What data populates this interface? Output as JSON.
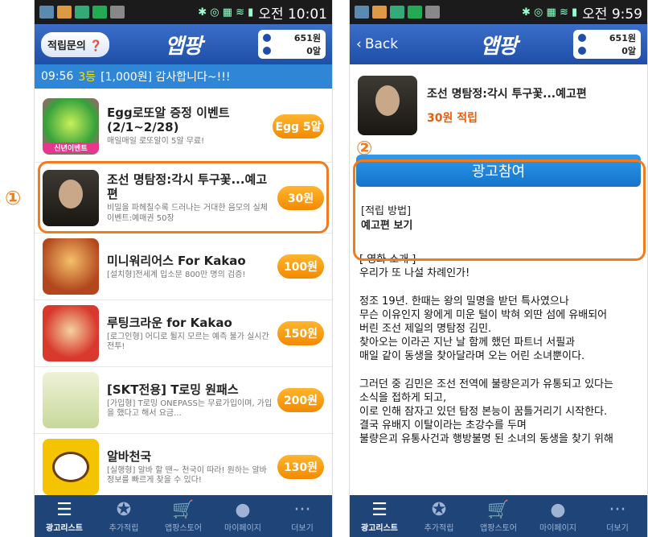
{
  "left": {
    "status": {
      "time": "오전 10:01"
    },
    "header": {
      "left_button": "적립문의",
      "logo": "앱팡",
      "points": [
        {
          "value": "651원"
        },
        {
          "value": "0알"
        }
      ]
    },
    "ticker": {
      "time": "09:56",
      "rank": "3등",
      "message": "[1,000원] 감사합니다~!!!"
    },
    "items": [
      {
        "title": "Egg로또알 증정 이벤트 (2/1~2/28)",
        "desc": "매일매일 로또알이 5알 무료!",
        "badge": "신년이벤트",
        "reward": "Egg 5알"
      },
      {
        "title": "조선 명탐정:각시 투구꽃...예고편",
        "desc": "비밀을 파헤칠수록 드러나는 거대한 음모의 실체",
        "desc2": "이벤트:예매권 50장",
        "reward": "30원"
      },
      {
        "title": "미니워리어스 For Kakao",
        "desc": "[설치형]전세계 입소문 800만 명의 검증!",
        "reward": "100원"
      },
      {
        "title": "루팅크라운 for Kakao",
        "desc": "[로그인형] 어디로 튈지 모르는 예측 불가 실시간 전투!",
        "reward": "150원"
      },
      {
        "title": "[SKT전용] T로밍 원패스",
        "desc": "[가입형] T로밍 ONEPASS는 무료가입이며, 가입을 했다고 해서 요금...",
        "reward": "200원"
      },
      {
        "title": "알바천국",
        "desc": "[실행형] 알바 할 땐~ 천국이 따라! 원하는 알바정보를 빠르게 찾을 수 있다!",
        "reward": "130원"
      }
    ],
    "marker": "①"
  },
  "right": {
    "status": {
      "time": "오전 9:59"
    },
    "header": {
      "back": "Back",
      "logo": "앱팡",
      "points": [
        {
          "value": "651원"
        },
        {
          "value": "0알"
        }
      ]
    },
    "detail": {
      "title": "조선 명탐정:각시 투구꽃...예고편",
      "reward": "30원 적립"
    },
    "marker": "②",
    "join_button": "광고참여",
    "how": {
      "label": "[적립 방법]",
      "text": "예고편 보기"
    },
    "story": {
      "heading": "[ 영화 소개 ]",
      "subheading": "우리가 또 나설 차례인가!",
      "para1": [
        "정조 19년. 한때는 왕의 밀명을 받던 특사였으나",
        "무슨 이유인지 왕에게 미운 털이 박혀 외딴 섬에 유배되어",
        "버린 조선 제일의 명탐정 김민.",
        "찾아오는 이라곤 지난 날 함께 했던 파트너 서필과",
        "매일 같이 동생을 찾아달라며 오는 어린 소녀뿐이다."
      ],
      "para2": [
        "그러던 중 김민은 조선 전역에 불량은괴가 유통되고 있다는",
        "소식을 접하게 되고,",
        "이로 인해 잠자고 있던 탐정 본능이 꿈틀거리기 시작한다.",
        "결국 유배지 이탈이라는 초강수를 두며",
        "불량은괴 유통사건과 행방불명 된 소녀의 동생을 찾기 위해"
      ]
    }
  },
  "nav": [
    {
      "label": "광고리스트",
      "icon": "list-icon"
    },
    {
      "label": "추가적립",
      "icon": "plus-coin-icon"
    },
    {
      "label": "앱팡스토어",
      "icon": "cart-icon"
    },
    {
      "label": "마이페이지",
      "icon": "person-icon"
    },
    {
      "label": "더보기",
      "icon": "more-icon"
    }
  ],
  "colors": {
    "accent": "#f07c1e",
    "header": "#1e4fa8",
    "ticker": "#2f86d6",
    "reward": "#f28a00",
    "nav": "#1f4478"
  }
}
